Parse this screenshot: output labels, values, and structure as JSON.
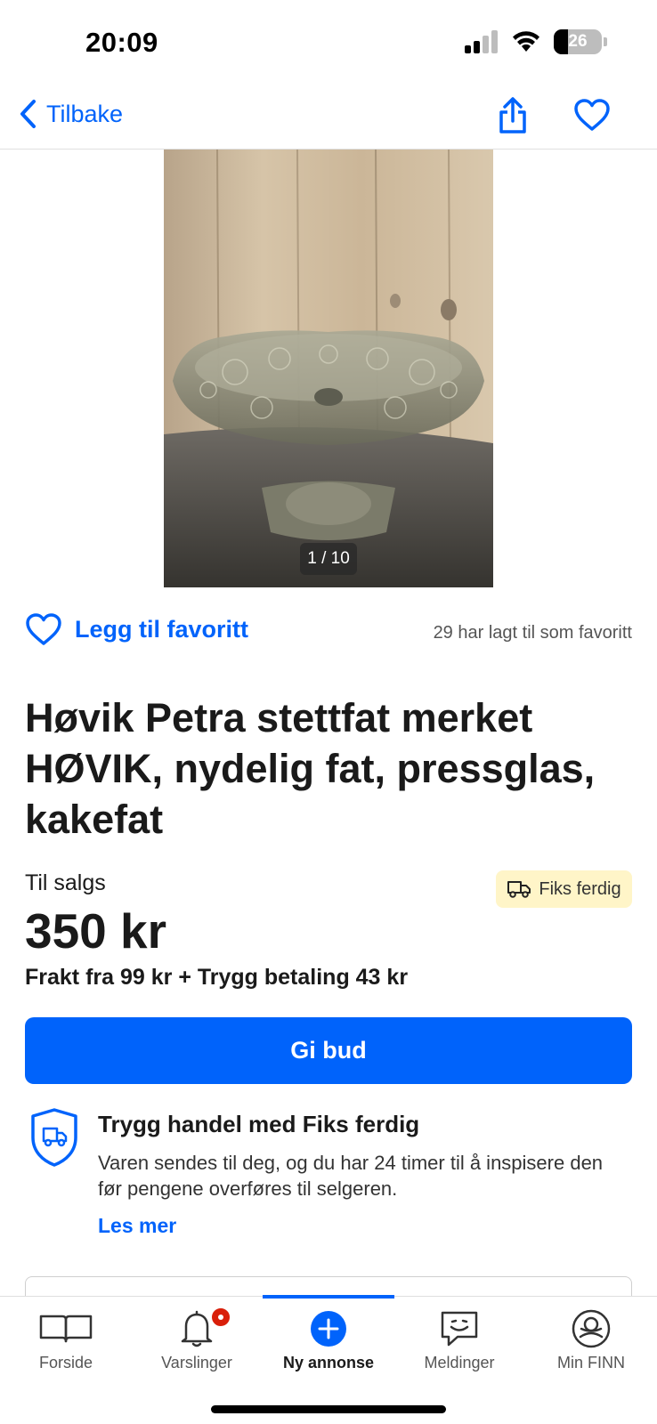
{
  "status_bar": {
    "time": "20:09",
    "battery": "26"
  },
  "nav": {
    "back_label": "Tilbake"
  },
  "image": {
    "counter": "1 / 10"
  },
  "favorite": {
    "add_label": "Legg til favoritt",
    "count_text": "29 har lagt til som favoritt"
  },
  "listing": {
    "title": "Høvik Petra stettfat merket HØVIK, nydelig fat, pressglas, kakefat",
    "sale_label": "Til salgs",
    "badge": "Fiks ferdig",
    "price": "350 kr",
    "shipping": "Frakt fra 99 kr + Trygg betaling 43 kr",
    "bid_button": "Gi bud"
  },
  "safe_trade": {
    "title": "Trygg handel med Fiks ferdig",
    "text": "Varen sendes til deg, og du har 24 timer til å inspisere den før pengene overføres til selgeren.",
    "read_more": "Les mer"
  },
  "tabs": [
    {
      "label": "Forside",
      "icon": "book-icon"
    },
    {
      "label": "Varslinger",
      "icon": "bell-icon"
    },
    {
      "label": "Ny annonse",
      "icon": "plus-circle-icon"
    },
    {
      "label": "Meldinger",
      "icon": "chat-icon"
    },
    {
      "label": "Min FINN",
      "icon": "profile-icon"
    }
  ],
  "colors": {
    "accent": "#0063fb",
    "badge_bg": "#fff5c8",
    "notification": "#d91f0a"
  }
}
